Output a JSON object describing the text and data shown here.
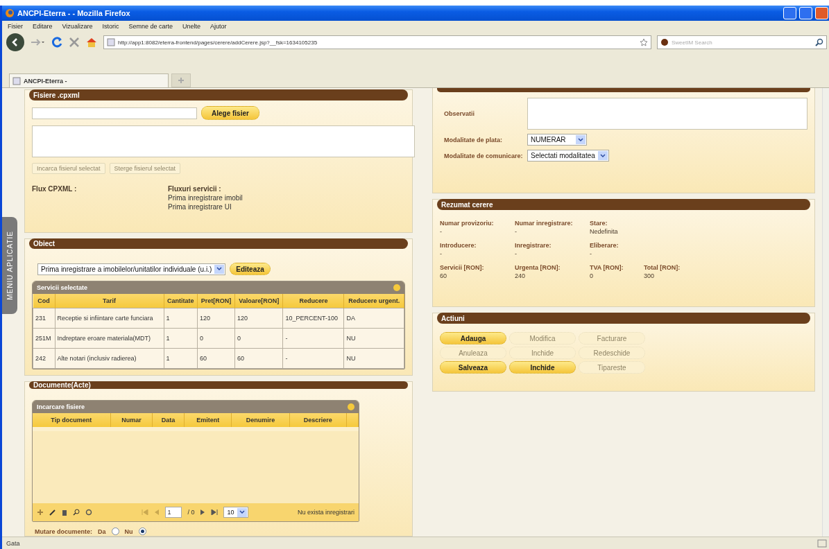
{
  "window": {
    "title": "ANCPI-Eterra - - Mozilla Firefox"
  },
  "menu": [
    "Fisier",
    "Editare",
    "Vizualizare",
    "Istoric",
    "Semne de carte",
    "Unelte",
    "Ajutor"
  ],
  "toolbar": {
    "url": "http://app1:8082/eterra-frontend/pages/cerere/addCerere.jsp?__fsk=1634105235",
    "search_placeholder": "SweetIM Search"
  },
  "tabs": [
    {
      "label": "ANCPI-Eterra -",
      "selected": true
    }
  ],
  "side_tab": "MENIU APLICATIE",
  "fisiere": {
    "title": "Fisiere .cpxml",
    "choose_button": "Alege fisier",
    "buttons": [
      {
        "label": "Incarca fisierul selectat",
        "disabled": true
      },
      {
        "label": "Sterge fisierul selectat",
        "disabled": true
      }
    ],
    "flux_label": "Flux CPXML :",
    "fluxuri_label": "Fluxuri servicii :",
    "fluxuri": [
      "Prima inregistrare imobil",
      "Prima inregistrare UI"
    ]
  },
  "obiect": {
    "title": "Obiect",
    "select_value": "Prima inregistrare a imobilelor/unitatilor individuale (u.i.)",
    "edit_button": "Editeaza",
    "grid": {
      "title": "Servicii selectate",
      "columns": [
        "Cod",
        "Tarif",
        "Cantitate",
        "Pret[RON]",
        "Valoare[RON]",
        "Reducere",
        "Reducere urgent."
      ],
      "rows": [
        [
          "231",
          "Receptie si infiintare carte funciara",
          "1",
          "120",
          "120",
          "10_PERCENT-100",
          "DA"
        ],
        [
          "251M",
          "Indreptare eroare materiala(MDT)",
          "1",
          "0",
          "0",
          "-",
          "NU"
        ],
        [
          "242",
          "Alte notari (inclusiv radierea)",
          "1",
          "60",
          "60",
          "-",
          "NU"
        ]
      ]
    }
  },
  "documente": {
    "title": "Documente(Acte)",
    "grid": {
      "title": "Incarcare fisiere",
      "columns": [
        "Tip document",
        "Numar",
        "Data",
        "Emitent",
        "Denumire",
        "Descriere"
      ],
      "page": "1",
      "page_total": "/ 0",
      "page_size": "10",
      "status": "Nu exista inregistrari"
    },
    "mutare": {
      "label": "Mutare documente:",
      "options": [
        {
          "label": "Da",
          "selected": false
        },
        {
          "label": "Nu",
          "selected": true
        }
      ]
    }
  },
  "date": {
    "observatii_label": "Observatii",
    "plata_label": "Modalitate de plata:",
    "plata_value": "NUMERAR",
    "comunicare_label": "Modalitate de comunicare:",
    "comunicare_value": "Selectati modalitatea"
  },
  "rezumat": {
    "title": "Rezumat cerere",
    "fields": [
      [
        {
          "label": "Numar provizoriu:",
          "value": "-"
        },
        {
          "label": "Numar inregistrare:",
          "value": "-"
        },
        {
          "label": "Stare:",
          "value": "Nedefinita"
        }
      ],
      [
        {
          "label": "Introducere:",
          "value": "-"
        },
        {
          "label": "Inregistrare:",
          "value": "-"
        },
        {
          "label": "Eliberare:",
          "value": "-"
        }
      ],
      [
        {
          "label": "Servicii [RON]:",
          "value": "60"
        },
        {
          "label": "Urgenta [RON]:",
          "value": "240"
        },
        {
          "label": "TVA [RON]:",
          "value": "0"
        },
        {
          "label": "Total [RON]:",
          "value": "300"
        }
      ]
    ]
  },
  "actiuni": {
    "title": "Actiuni",
    "buttons": [
      {
        "label": "Adauga",
        "disabled": false
      },
      {
        "label": "Modifica",
        "disabled": true
      },
      {
        "label": "Facturare",
        "disabled": true
      },
      {
        "label": "Anuleaza",
        "disabled": true
      },
      {
        "label": "Inchide",
        "disabled": true
      },
      {
        "label": "Redeschide",
        "disabled": true
      },
      {
        "label": "Salveaza",
        "disabled": false
      },
      {
        "label": "Inchide",
        "disabled": false
      },
      {
        "label": "Tipareste",
        "disabled": true
      }
    ]
  },
  "status_bar": "Gata"
}
